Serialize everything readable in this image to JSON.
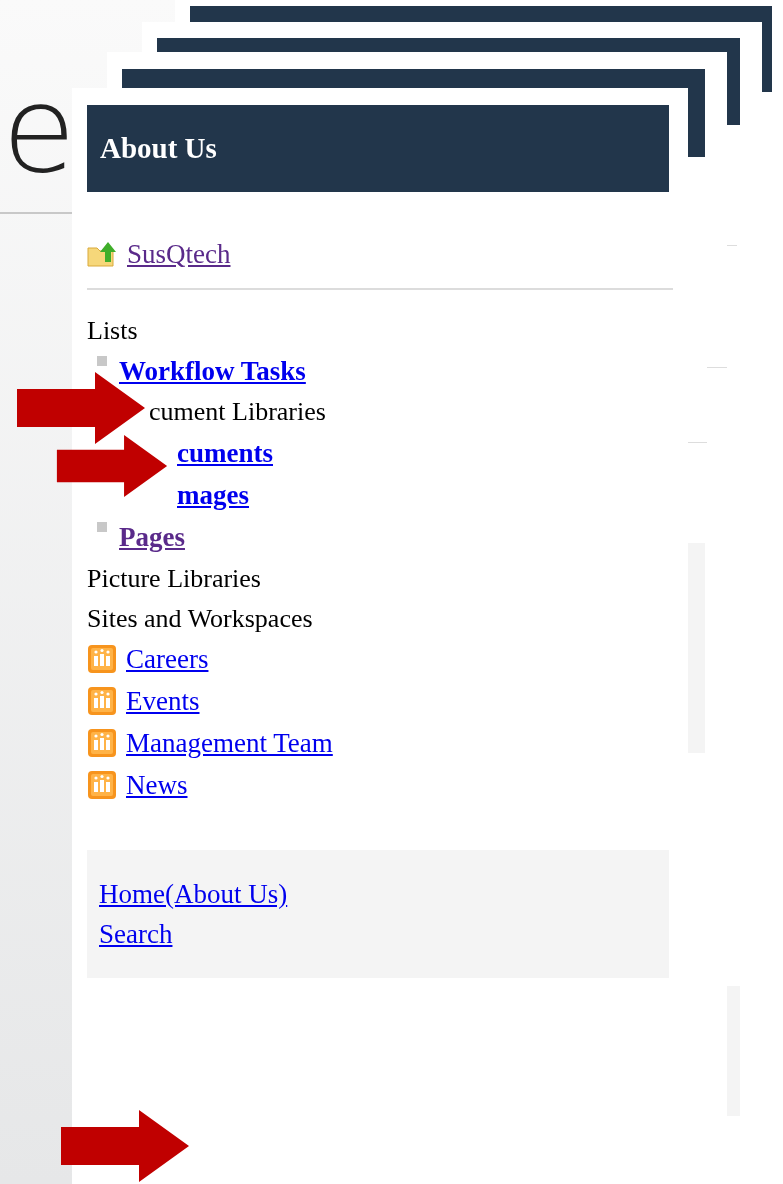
{
  "slide_title": "e",
  "panel": {
    "title": "About Us",
    "parent_link": {
      "label": "SusQtech",
      "visited": true
    },
    "nav": [
      {
        "kind": "heading",
        "label": "Lists"
      },
      {
        "kind": "list_item",
        "label": "Workflow Tasks",
        "visited": false
      },
      {
        "kind": "covered_heading",
        "label": "cument Libraries"
      },
      {
        "kind": "covered_list_item",
        "label": "cuments",
        "visited": false
      },
      {
        "kind": "covered_list_item",
        "label": "mages",
        "visited": false
      },
      {
        "kind": "list_item",
        "label": "Pages",
        "visited": true
      },
      {
        "kind": "heading",
        "label": "Picture Libraries"
      },
      {
        "kind": "heading",
        "label": "Sites and Workspaces"
      },
      {
        "kind": "site",
        "label": "Careers",
        "visited": false
      },
      {
        "kind": "site",
        "label": "Events",
        "visited": false
      },
      {
        "kind": "site",
        "label": "Management Team",
        "visited": false
      },
      {
        "kind": "site",
        "label": "News",
        "visited": false
      }
    ],
    "footer_links": [
      "Home(About Us)",
      "Search"
    ]
  }
}
